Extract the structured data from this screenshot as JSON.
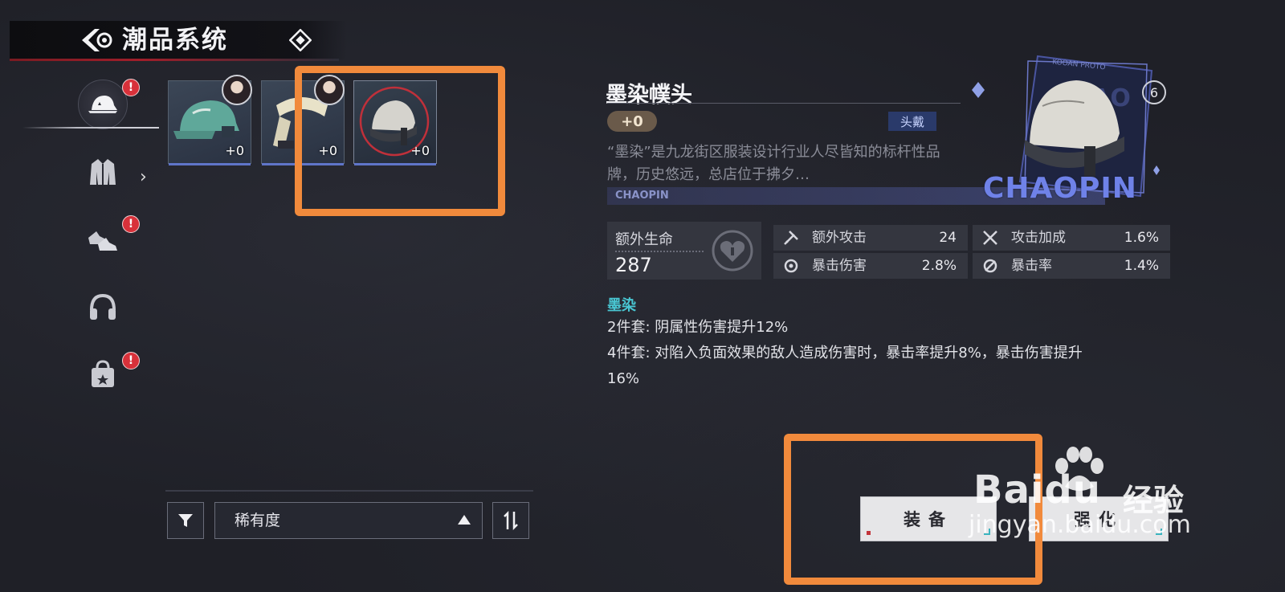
{
  "header": {
    "title": "潮品系统",
    "back_icon": "back-arrow-icon",
    "info_icon": "diamond-info-icon"
  },
  "sidebar": {
    "items": [
      {
        "name": "hat",
        "icon": "hat-icon",
        "badge": "!",
        "active": true
      },
      {
        "name": "jacket",
        "icon": "jacket-icon",
        "badge": "",
        "active": false
      },
      {
        "name": "shoes",
        "icon": "shoes-icon",
        "badge": "!",
        "active": false
      },
      {
        "name": "headphones",
        "icon": "headphones-icon",
        "badge": "!",
        "active": false
      },
      {
        "name": "bag",
        "icon": "bag-icon",
        "badge": "!",
        "active": false
      }
    ],
    "badge_text": "!"
  },
  "inventory": {
    "slots": [
      {
        "item": "cap",
        "count": "+0",
        "has_avatar": true
      },
      {
        "item": "scarf",
        "count": "+0",
        "has_avatar": true
      },
      {
        "item": "ink-hat",
        "count": "+0",
        "has_avatar": false,
        "selected": true
      }
    ]
  },
  "filter": {
    "sort_label": "稀有度",
    "filter_icon": "funnel-icon",
    "sort_order_icon": "sort-order-icon"
  },
  "detail": {
    "name": "墨染幞头",
    "level": "+0",
    "slot_tag": "头戴",
    "description": "“墨染”是九龙街区服装设计行业人尽皆知的标杆性品牌，历史悠远，总店位于拂夕…",
    "strip_text": "CHAOPIN",
    "card_text": "CHAOPIN",
    "card_sub": "KOOAN PROTO",
    "card_number": "6",
    "main_stat": {
      "label": "额外生命",
      "value": "287"
    },
    "stats": [
      {
        "label": "额外攻击",
        "value": "24",
        "icon": "attack-icon"
      },
      {
        "label": "攻击加成",
        "value": "1.6%",
        "icon": "crossed-swords-icon"
      },
      {
        "label": "暴击伤害",
        "value": "2.8%",
        "icon": "crit-damage-icon"
      },
      {
        "label": "暴击率",
        "value": "1.4%",
        "icon": "crit-rate-icon"
      }
    ],
    "set": {
      "name": "墨染",
      "bonus2": "2件套: 阴属性伤害提升12%",
      "bonus4_line1": "4件套: 对陷入负面效果的敌人造成伤害时，暴击率提升8%，暴击伤害提升",
      "bonus4_line2": "16%"
    }
  },
  "actions": {
    "equip": "装备",
    "enhance": "强化"
  },
  "watermark": {
    "logo": "Baidu",
    "sub": "经验",
    "url": "jingyan.baidu.com"
  },
  "colors": {
    "highlight": "#f18a3c",
    "accent_red": "#a01e2a",
    "set_name": "#49c6d2",
    "badge": "#d8313a"
  }
}
